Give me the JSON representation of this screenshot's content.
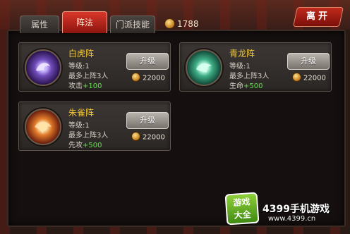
{
  "tabs": [
    {
      "label": "属性"
    },
    {
      "label": "阵法"
    },
    {
      "label": "门派技能"
    }
  ],
  "currency": {
    "amount": "1788",
    "icon": "gold-coin-icon"
  },
  "leave_label": "离开",
  "formations": [
    {
      "name": "白虎阵",
      "level": "等级:1",
      "max": "最多上阵3人",
      "bonus_label": "攻击",
      "bonus_value": "+100",
      "button": "升级",
      "cost": "22000",
      "emblem": "white-tiger-icon"
    },
    {
      "name": "青龙阵",
      "level": "等级:1",
      "max": "最多上阵3人",
      "bonus_label": "生命",
      "bonus_value": "+500",
      "button": "升级",
      "cost": "22000",
      "emblem": "azure-dragon-icon"
    },
    {
      "name": "朱雀阵",
      "level": "等级:1",
      "max": "最多上阵3人",
      "bonus_label": "先攻",
      "bonus_value": "+500",
      "button": "升级",
      "cost": "22000",
      "emblem": "vermilion-bird-icon"
    }
  ],
  "watermark": {
    "logo_line1": "游戏",
    "logo_line2": "大全",
    "title": "4399手机游戏",
    "url": "www.4399.cn"
  },
  "colors": {
    "active_tab": "#c52a1e",
    "name": "#f0c63a",
    "bonus": "#5ee04a"
  }
}
